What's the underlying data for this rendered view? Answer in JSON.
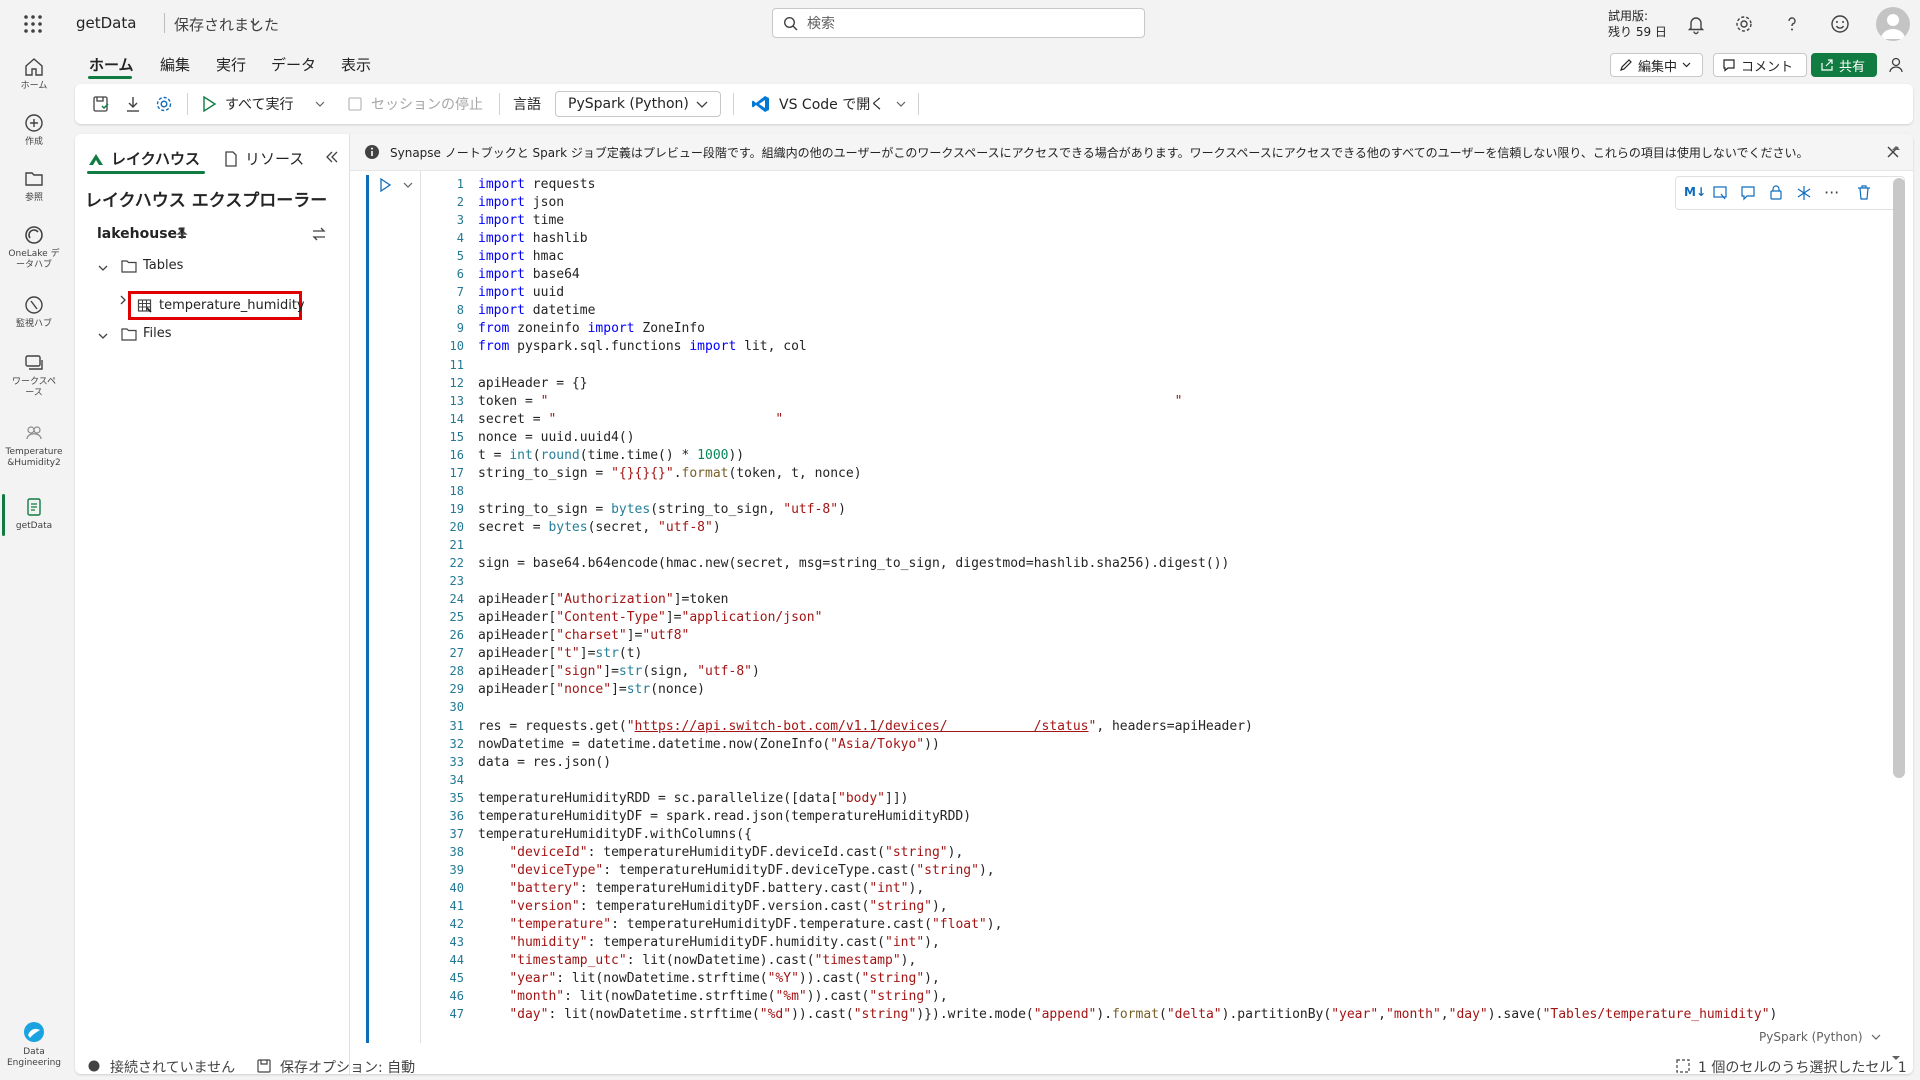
{
  "header": {
    "doc_title": "getData",
    "save_state": "保存されました",
    "search_placeholder": "検索",
    "trial_line1": "試用版:",
    "trial_line2": "残り 59 日"
  },
  "ribbon": {
    "tabs": [
      "ホーム",
      "編集",
      "実行",
      "データ",
      "表示"
    ],
    "editing_label": "編集中",
    "comment_label": "コメント",
    "share_label": "共有"
  },
  "toolbar": {
    "run_all_label": "すべて実行",
    "stop_session_label": "セッションの停止",
    "language_label": "言語",
    "language_value": "PySpark (Python)",
    "vscode_label": "VS Code で開く"
  },
  "rail": {
    "items": [
      {
        "label": "ホーム",
        "icon": "home-icon"
      },
      {
        "label": "作成",
        "icon": "plus-circle-icon"
      },
      {
        "label": "参照",
        "icon": "folder-icon"
      },
      {
        "label": "OneLake データハブ",
        "line1": "OneLake デ",
        "line2": "ータハブ",
        "icon": "onelake-icon"
      },
      {
        "label": "監視ハブ",
        "icon": "monitor-icon"
      },
      {
        "label": "ワークスペース",
        "line1": "ワークスペ",
        "line2": "ース",
        "icon": "workspace-icon"
      },
      {
        "label": "Temperature&Humidity2",
        "line1": "Temperature",
        "line2": "&Humidity2",
        "icon": "workspace-item-icon"
      },
      {
        "label": "getData",
        "icon": "notebook-icon"
      }
    ],
    "footer_line1": "Data",
    "footer_line2": "Engineering"
  },
  "explorer": {
    "tab_lakehouse": "レイクハウス",
    "tab_resources": "リソース",
    "title": "レイクハウス エクスプローラー",
    "lakehouse_name": "lakehouse1",
    "tables_label": "Tables",
    "table_item": "temperature_humidity",
    "files_label": "Files"
  },
  "notice": {
    "text": "Synapse ノートブックと Spark ジョブ定義はプレビュー段階です。組織内の他のユーザーがこのワークスペースにアクセスできる場合があります。ワークスペースにアクセスできる他のすべてのユーザーを信頼しない限り、これらの項目は使用しないでください。"
  },
  "cell": {
    "language_tag": "PySpark (Python)",
    "code_lines": [
      "import requests",
      "import json",
      "import time",
      "import hashlib",
      "import hmac",
      "import base64",
      "import uuid",
      "import datetime",
      "from zoneinfo import ZoneInfo",
      "from pyspark.sql.functions import lit, col",
      "",
      "apiHeader = {}",
      "token = \"                                                                                \"",
      "secret = \"                            \"",
      "nonce = uuid.uuid4()",
      "t = int(round(time.time() * 1000))",
      "string_to_sign = \"{}{}{}\".format(token, t, nonce)",
      "",
      "string_to_sign = bytes(string_to_sign, \"utf-8\")",
      "secret = bytes(secret, \"utf-8\")",
      "",
      "sign = base64.b64encode(hmac.new(secret, msg=string_to_sign, digestmod=hashlib.sha256).digest())",
      "",
      "apiHeader[\"Authorization\"]=token",
      "apiHeader[\"Content-Type\"]=\"application/json\"",
      "apiHeader[\"charset\"]=\"utf8\"",
      "apiHeader[\"t\"]=str(t)",
      "apiHeader[\"sign\"]=str(sign, \"utf-8\")",
      "apiHeader[\"nonce\"]=str(nonce)",
      "",
      "res = requests.get(\"https://api.switch-bot.com/v1.1/devices/           /status\", headers=apiHeader)",
      "nowDatetime = datetime.datetime.now(ZoneInfo(\"Asia/Tokyo\"))",
      "data = res.json()",
      "",
      "temperatureHumidityRDD = sc.parallelize([data[\"body\"]])",
      "temperatureHumidityDF = spark.read.json(temperatureHumidityRDD)",
      "temperatureHumidityDF.withColumns({",
      "    \"deviceId\": temperatureHumidityDF.deviceId.cast(\"string\"),",
      "    \"deviceType\": temperatureHumidityDF.deviceType.cast(\"string\"),",
      "    \"battery\": temperatureHumidityDF.battery.cast(\"int\"),",
      "    \"version\": temperatureHumidityDF.version.cast(\"string\"),",
      "    \"temperature\": temperatureHumidityDF.temperature.cast(\"float\"),",
      "    \"humidity\": temperatureHumidityDF.humidity.cast(\"int\"),",
      "    \"timestamp_utc\": lit(nowDatetime).cast(\"timestamp\"),",
      "    \"year\": lit(nowDatetime.strftime(\"%Y\")).cast(\"string\"),",
      "    \"month\": lit(nowDatetime.strftime(\"%m\")).cast(\"string\"),",
      "    \"day\": lit(nowDatetime.strftime(\"%d\")).cast(\"string\")}).write.mode(\"append\").format(\"delta\").partitionBy(\"year\",\"month\",\"day\").save(\"Tables/temperature_humidity\")"
    ]
  },
  "status": {
    "connection": "接続されていません",
    "save_option": "保存オプション: 自動",
    "selection": "1 個のセルのうち選択したセル 1"
  },
  "colors": {
    "accent": "#107c41",
    "cell_active": "#0f6cbd",
    "highlight_box": "#e00000"
  }
}
